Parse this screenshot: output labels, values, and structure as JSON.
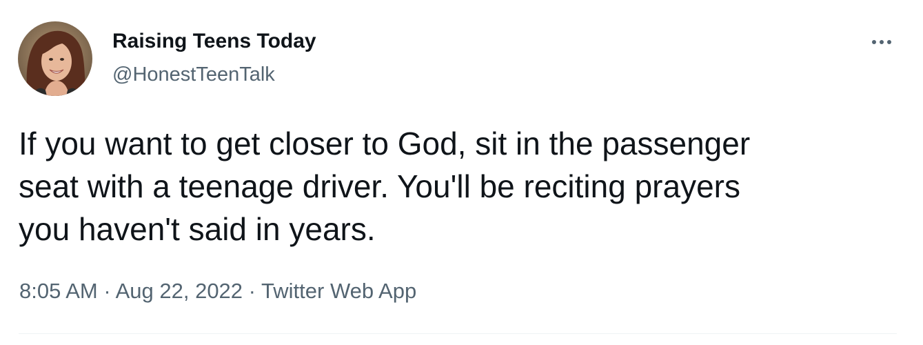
{
  "author": {
    "display_name": "Raising Teens Today",
    "handle": "@HonestTeenTalk"
  },
  "tweet": {
    "text": "If you want to get closer to God, sit in the passenger\nseat with a teenage driver. You'll be reciting prayers\nyou haven't said in years."
  },
  "meta": {
    "time": "8:05 AM",
    "separator": " · ",
    "date": "Aug 22, 2022",
    "source": "Twitter Web App"
  },
  "icons": {
    "more": "more-horizontal-icon"
  },
  "colors": {
    "text_primary": "#0f1419",
    "text_secondary": "#536471",
    "divider": "#eff3f4"
  }
}
